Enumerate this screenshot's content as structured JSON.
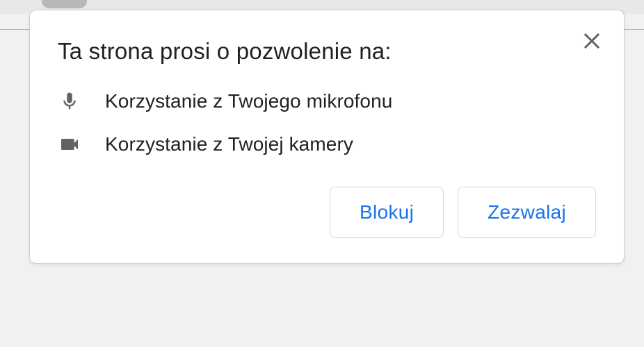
{
  "dialog": {
    "title": "Ta strona prosi o pozwolenie na:",
    "permissions": {
      "microphone": "Korzystanie z Twojego mikrofonu",
      "camera": "Korzystanie z Twojej kamery"
    },
    "buttons": {
      "block": "Blokuj",
      "allow": "Zezwalaj"
    }
  }
}
